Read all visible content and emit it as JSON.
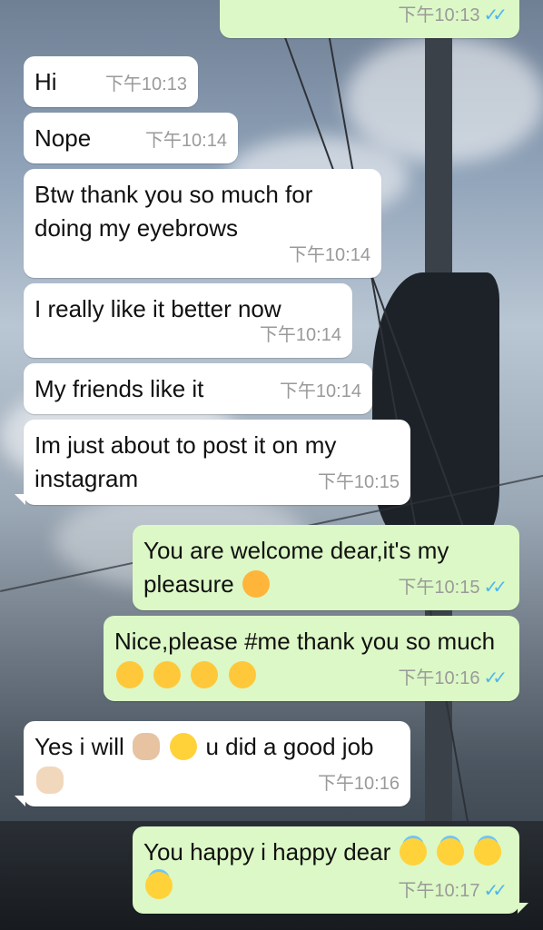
{
  "chat": {
    "messages": [
      {
        "id": 0,
        "dir": "out",
        "text": "",
        "time": "下午10:13",
        "read": "✓✓"
      },
      {
        "id": 1,
        "dir": "in",
        "text": "Hi",
        "time": "下午10:13"
      },
      {
        "id": 2,
        "dir": "in",
        "text": "Nope",
        "time": "下午10:14"
      },
      {
        "id": 3,
        "dir": "in",
        "text": "Btw thank you so much for doing my eyebrows",
        "time": "下午10:14"
      },
      {
        "id": 4,
        "dir": "in",
        "text": "I really like it better now",
        "time": "下午10:14"
      },
      {
        "id": 5,
        "dir": "in",
        "text": "My friends like it",
        "time": "下午10:14"
      },
      {
        "id": 6,
        "dir": "in",
        "text": "Im just about to post it on my instagram",
        "time": "下午10:15"
      },
      {
        "id": 7,
        "dir": "out",
        "text": "You are welcome dear,it's my pleasure",
        "time": "下午10:15",
        "read": "✓✓",
        "emojis": [
          "smiling-face-with-hearts"
        ]
      },
      {
        "id": 8,
        "dir": "out",
        "text": "Nice,please #me thank you so much",
        "time": "下午10:16",
        "read": "✓✓",
        "emojis": [
          "kissing-heart",
          "kissing-heart",
          "kissing-heart",
          "kissing-heart"
        ]
      },
      {
        "id": 9,
        "dir": "in",
        "text_a": "Yes i will",
        "text_b": "u did a good job",
        "time": "下午10:16",
        "emojis": [
          "thumbs-up",
          "smiling-face",
          "clapping-hands"
        ]
      },
      {
        "id": 10,
        "dir": "out",
        "text": "You happy i happy dear",
        "time": "下午10:17",
        "read": "✓✓",
        "emojis": [
          "halo-face",
          "halo-face",
          "halo-face",
          "halo-face"
        ]
      }
    ]
  },
  "colors": {
    "incoming_bubble": "#ffffff",
    "outgoing_bubble": "#dcf8c6",
    "read_ticks": "#4fb6ec",
    "timestamp": "#9a9a9a"
  }
}
